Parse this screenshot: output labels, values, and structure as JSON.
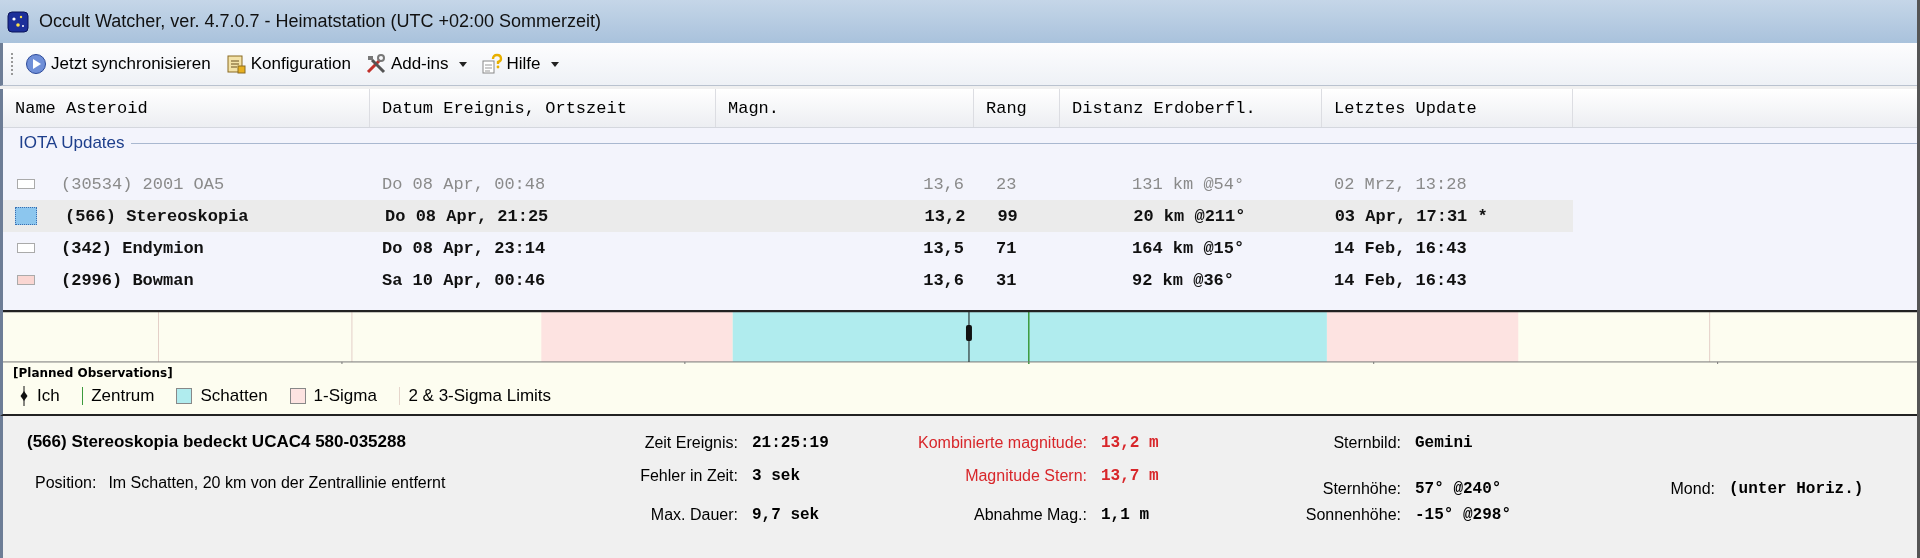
{
  "window": {
    "title": "Occult Watcher, ver. 4.7.0.7 - Heimatstation (UTC +02:00 Sommerzeit)"
  },
  "toolbar": [
    {
      "kind": "sync",
      "label": "Jetzt synchronisieren",
      "has_menu": false
    },
    {
      "kind": "config",
      "label": "Konfiguration",
      "has_menu": false
    },
    {
      "kind": "tools",
      "label": "Add-ins",
      "has_menu": true
    },
    {
      "kind": "help",
      "label": "Hilfe",
      "has_menu": true
    }
  ],
  "table": {
    "columns": [
      "Name Asteroid",
      "Datum Ereignis, Ortszeit",
      "Magn.",
      "Rang",
      "Distanz Erdoberfl.",
      "Letztes Update"
    ],
    "group": "IOTA Updates",
    "rows": [
      {
        "color": "#ffffff",
        "selected": false,
        "dimmed": true,
        "cells": [
          "(30534) 2001 OA5",
          "Do 08 Apr, 00:48",
          "13,6",
          "23",
          "131 km @54°",
          "02 Mrz, 13:28"
        ]
      },
      {
        "color": "#8cc6ee",
        "selected": true,
        "dimmed": false,
        "cells": [
          "(566) Stereoskopia",
          "Do 08 Apr, 21:25",
          "13,2",
          "99",
          "20 km @211°",
          "03 Apr, 17:31 *"
        ]
      },
      {
        "color": "#ffffff",
        "selected": false,
        "dimmed": false,
        "cells": [
          "(342) Endymion",
          "Do 08 Apr, 23:14",
          "13,5",
          "71",
          "164 km @15°",
          "14 Feb, 16:43"
        ]
      },
      {
        "color": "#fad6d2",
        "selected": false,
        "dimmed": false,
        "cells": [
          "(2996) Bowman",
          "Sa 10 Apr, 00:46",
          "13,6",
          "31",
          "92 km @36°",
          "14 Feb, 16:43"
        ]
      }
    ]
  },
  "strip": {
    "heading": "[Planned Observations]",
    "legend": [
      {
        "kind": "observer",
        "label": "Ich"
      },
      {
        "kind": "center",
        "label": "Zentrum",
        "color": "#3c9a3c"
      },
      {
        "kind": "swatch",
        "label": "Schatten",
        "color": "#b0ecee"
      },
      {
        "kind": "swatch",
        "label": "1-Sigma",
        "color": "#fde3e1"
      },
      {
        "kind": "limit",
        "label": "2 & 3-Sigma Limits",
        "color": "#e6d6cc"
      }
    ]
  },
  "details": {
    "title": "(566) Stereoskopia bedeckt UCAC4 580-035288",
    "position_label": "Position:",
    "position": "Im Schatten, 20 km von der Zentrallinie entfernt",
    "columns": [
      [
        {
          "label": "Zeit Ereignis:",
          "value": "21:25:19",
          "highlight": false
        },
        {
          "label": "Fehler in Zeit:",
          "value": "3 sek",
          "highlight": false
        },
        {
          "label": "Max. Dauer:",
          "value": "9,7 sek",
          "highlight": false
        }
      ],
      [
        {
          "label": "Kombinierte magnitude:",
          "value": "13,2 m",
          "highlight": true
        },
        {
          "label": "Magnitude Stern:",
          "value": "13,7 m",
          "highlight": true
        },
        {
          "label": "Abnahme Mag.:",
          "value": "1,1 m",
          "highlight": false
        }
      ],
      [
        {
          "label": "Sternbild:",
          "value": "Gemini",
          "highlight": false
        },
        {
          "label": "Sternhöhe:",
          "value": "57° @240°",
          "highlight": false
        },
        {
          "label": "Sonnenhöhe:",
          "value": "-15° @298°",
          "highlight": false
        }
      ],
      [
        {
          "label": "Mond:",
          "value": "(unter Horiz.)",
          "highlight": false
        }
      ]
    ]
  }
}
